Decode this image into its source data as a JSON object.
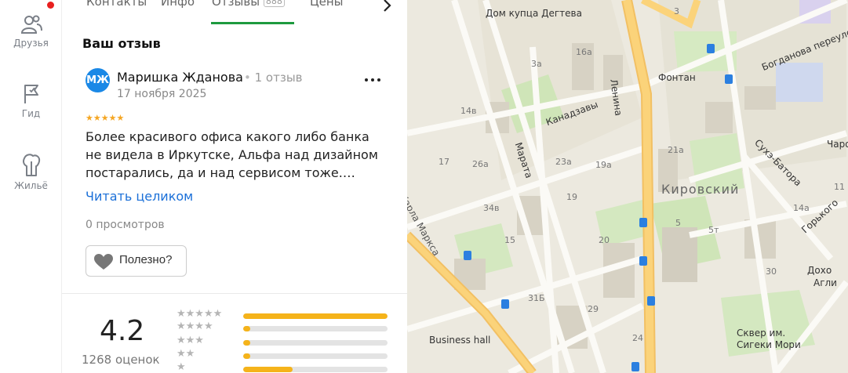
{
  "sidebar": {
    "items": [
      {
        "label": "Друзья",
        "icon": "friends-icon"
      },
      {
        "label": "Гид",
        "icon": "flag-icon"
      },
      {
        "label": "Жильё",
        "icon": "housing-icon"
      }
    ],
    "notification_color": "#e8201f"
  },
  "tabs": {
    "items": [
      "Контакты",
      "Инфо",
      "Отзывы",
      "Цены"
    ],
    "reviews_count": "888",
    "active": "Отзывы",
    "accent": "#1d9a3e"
  },
  "review": {
    "section_title": "Ваш отзыв",
    "author": {
      "initials": "МЖ",
      "name": "Маришка Жданова",
      "meta": "1 отзыв"
    },
    "date": "17 ноября 2025",
    "stars": 5,
    "stars_text": "★★★★★",
    "text": "Более красивого офиса какого либо банка не видела в Иркутске, Альфа над дизайном постарались, да и над сервисом тоже.…",
    "read_more": "Читать целиком",
    "views": "0 просмотров",
    "useful_label": "Полезно?"
  },
  "rating": {
    "value": "4.2",
    "count": "1268 оценок",
    "distribution": [
      {
        "stars": "★★★★★",
        "fraction": 1.0
      },
      {
        "stars": "★★★★",
        "fraction": 0.05
      },
      {
        "stars": "★★★",
        "fraction": 0.05
      },
      {
        "stars": "★★",
        "fraction": 0.05
      },
      {
        "stars": "★",
        "fraction": 0.34
      }
    ]
  },
  "map": {
    "district": "Кировский",
    "labels": [
      "Дом купца Дегтева",
      "Фонтан",
      "Ленина",
      "Марата",
      "Канадзавы",
      "Сухэ-Батора",
      "Горького",
      "Богданова переулок",
      "Business hall",
      "Сквер им. Сигеки Мори",
      "Чарои",
      "Дохо",
      "Агли",
      "Карла Маркса"
    ],
    "house_numbers": [
      "16а",
      "3а",
      "14в",
      "17",
      "26а",
      "23а",
      "19а",
      "21а",
      "34в",
      "19",
      "15",
      "20",
      "31Б",
      "29",
      "24",
      "30",
      "3",
      "5т",
      "5",
      "14а",
      "11"
    ]
  }
}
